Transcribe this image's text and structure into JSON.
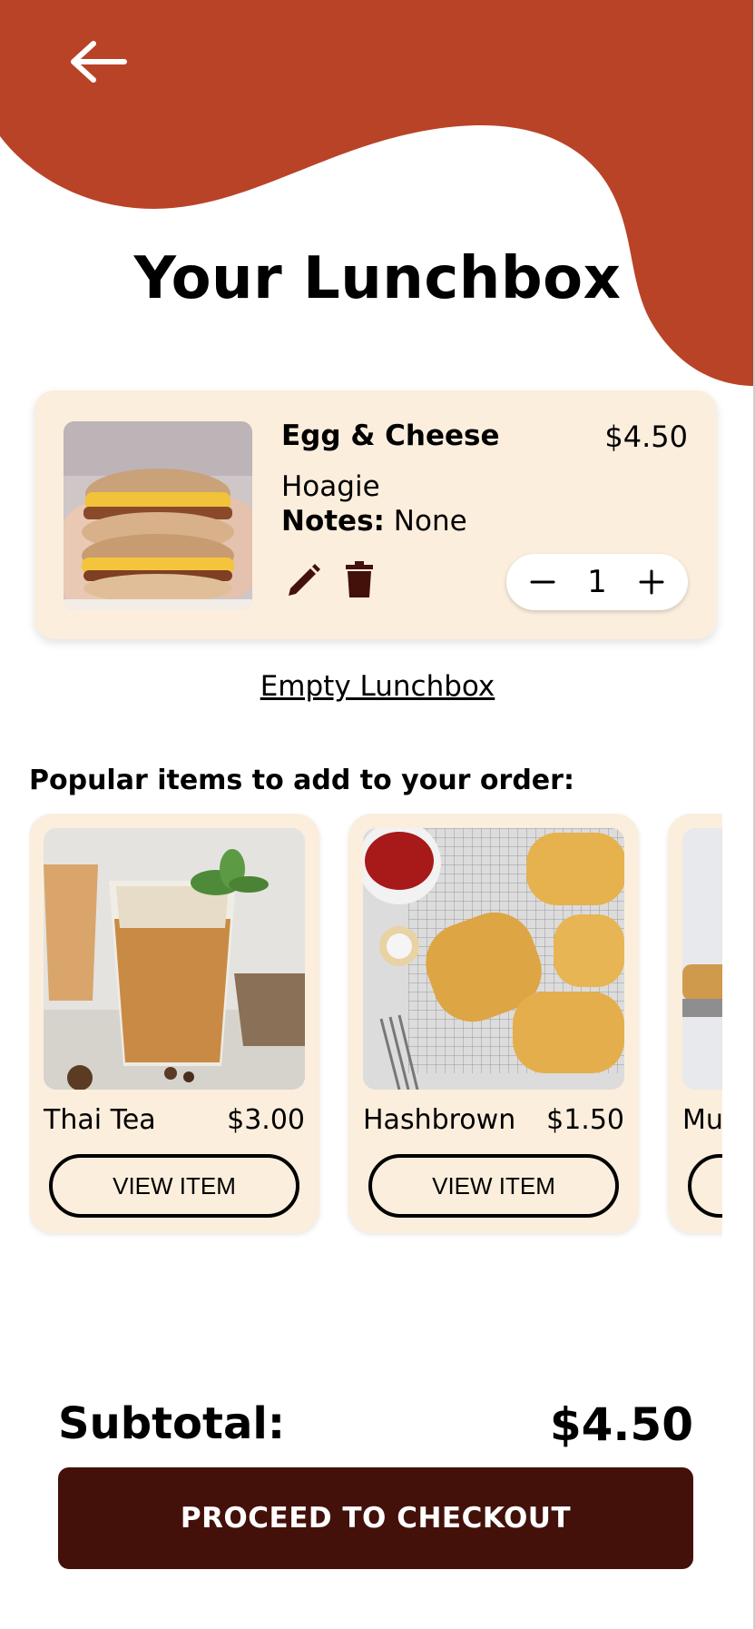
{
  "header": {
    "back_icon": "arrow-left-icon",
    "title": "Your Lunchbox"
  },
  "colors": {
    "accent": "#b94327",
    "card_bg": "#fbeedd",
    "checkout_bg": "#43110a"
  },
  "cart": {
    "items": [
      {
        "name": "Egg & Cheese",
        "price": "$4.50",
        "variant": "Hoagie",
        "notes_label": "Notes:",
        "notes_value": "None",
        "quantity": "1",
        "edit_icon": "pencil-icon",
        "delete_icon": "trash-icon",
        "decrement_icon": "minus-icon",
        "increment_icon": "plus-icon"
      }
    ],
    "empty_link": "Empty Lunchbox"
  },
  "popular": {
    "heading": "Popular items to add to your order:",
    "items": [
      {
        "name": "Thai Tea",
        "price": "$3.00",
        "button_label": "VIEW ITEM"
      },
      {
        "name": "Hashbrown",
        "price": "$1.50",
        "button_label": "VIEW ITEM"
      },
      {
        "name": "Mu",
        "price": "",
        "button_label": ""
      }
    ]
  },
  "footer": {
    "subtotal_label": "Subtotal:",
    "subtotal_value": "$4.50",
    "checkout_label": "PROCEED TO CHECKOUT"
  }
}
